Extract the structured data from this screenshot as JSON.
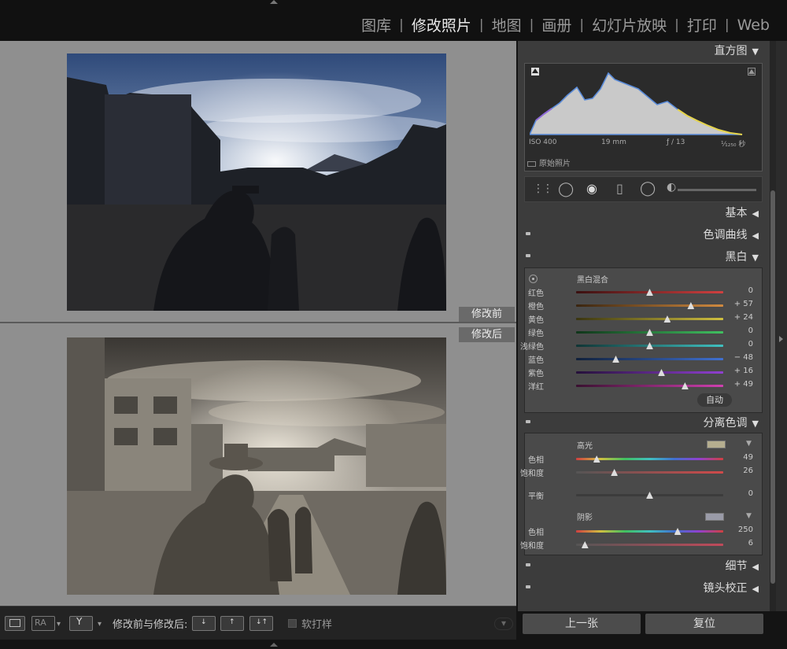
{
  "modules": [
    "图库",
    "修改照片",
    "地图",
    "画册",
    "幻灯片放映",
    "打印",
    "Web"
  ],
  "active_module": "修改照片",
  "view_labels": {
    "before": "修改前",
    "after": "修改后"
  },
  "panel": {
    "histogram": {
      "title": "直方图",
      "iso": "ISO 400",
      "focal": "19 mm",
      "aperture": "ƒ / 13",
      "shutter": "¹⁄₁₂₅₀ 秒",
      "original_photo": "原始照片"
    },
    "sections": {
      "basic": "基本",
      "tone_curve": "色调曲线",
      "bw": "黑白",
      "split_toning": "分离色调",
      "detail": "细节",
      "lens": "镜头校正"
    },
    "bw_mix": {
      "title": "黑白混合",
      "sliders": [
        {
          "label": "红色",
          "value": "0",
          "pos": 0.5
        },
        {
          "label": "橙色",
          "value": "+ 57",
          "pos": 0.78
        },
        {
          "label": "黄色",
          "value": "+ 24",
          "pos": 0.62
        },
        {
          "label": "绿色",
          "value": "0",
          "pos": 0.5
        },
        {
          "label": "浅绿色",
          "value": "0",
          "pos": 0.5
        },
        {
          "label": "蓝色",
          "value": "− 48",
          "pos": 0.27
        },
        {
          "label": "紫色",
          "value": "+ 16",
          "pos": 0.58
        },
        {
          "label": "洋红",
          "value": "+ 49",
          "pos": 0.74
        }
      ],
      "auto": "自动"
    },
    "split": {
      "highlight_title": "高光",
      "highlight_hue_label": "色相",
      "highlight_hue_value": "49",
      "highlight_hue_pos": 0.14,
      "highlight_sat_label": "饱和度",
      "highlight_sat_value": "26",
      "highlight_sat_pos": 0.26,
      "balance_label": "平衡",
      "balance_value": "0",
      "balance_pos": 0.5,
      "shadow_title": "阴影",
      "shadow_hue_label": "色相",
      "shadow_hue_value": "250",
      "shadow_hue_pos": 0.69,
      "shadow_sat_label": "饱和度",
      "shadow_sat_value": "6",
      "shadow_sat_pos": 0.06,
      "highlight_color": "#b5ae8f",
      "shadow_color": "#9a9ba8"
    }
  },
  "toolbar": {
    "compare_label": "修改前与修改后:",
    "soft_proof": "软打样"
  },
  "nav": {
    "prev": "上一张",
    "reset": "复位"
  }
}
